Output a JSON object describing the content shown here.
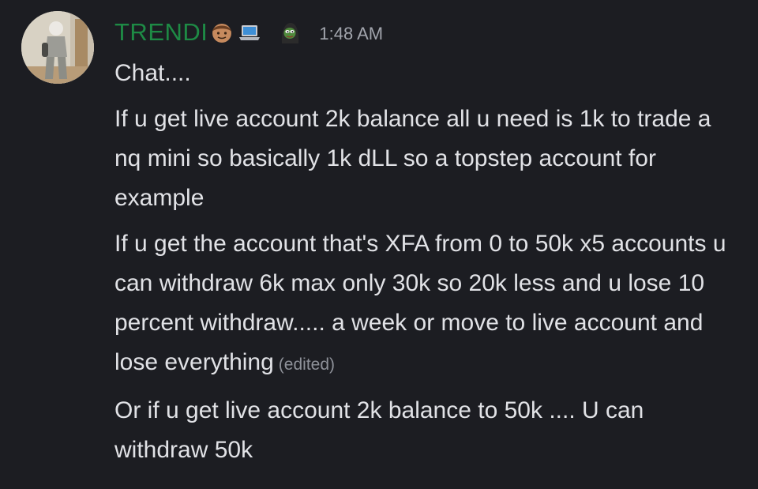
{
  "author": {
    "name": "TRENDI",
    "name_color": "#1e8a45",
    "badges": [
      "man-medium-skin-tone-emoji",
      "laptop-emoji",
      "pepe-hoodie-emoji"
    ]
  },
  "timestamp": "1:48 AM",
  "messages": [
    {
      "text": "Chat....",
      "edited": ""
    },
    {
      "text": "If u get live account 2k balance all u need is 1k to trade a nq mini so basically 1k dLL so a topstep account for example",
      "edited": ""
    },
    {
      "text": "If u get the account that's XFA from 0 to 50k x5 accounts u can withdraw 6k max only 30k so 20k less and u lose 10 percent withdraw..... a week or move to live account and lose everything",
      "edited": "(edited)"
    },
    {
      "text": "Or if u get live account 2k balance to 50k .... U can withdraw 50k",
      "edited": ""
    }
  ],
  "colors": {
    "background": "#1c1d22",
    "text": "#e1e2e6",
    "timestamp": "#a2a5ad",
    "edited": "#8e9199"
  }
}
